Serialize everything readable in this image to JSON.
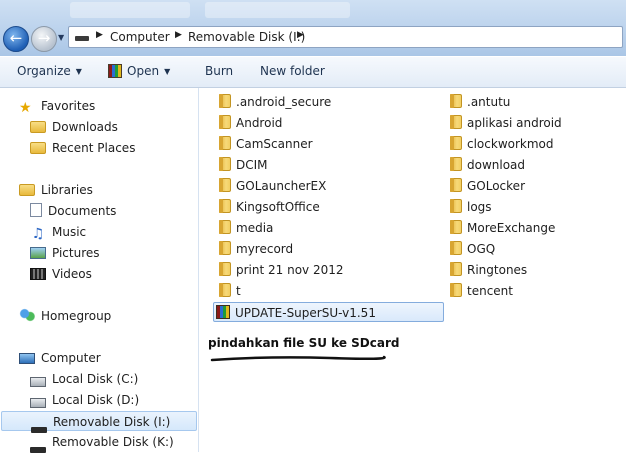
{
  "address": {
    "segments": [
      "Computer",
      "Removable Disk (I:)"
    ]
  },
  "toolbar": {
    "organize": "Organize",
    "open": "Open",
    "burn": "Burn",
    "new_folder": "New folder"
  },
  "nav": {
    "favorites": "Favorites",
    "downloads": "Downloads",
    "recent_places": "Recent Places",
    "libraries": "Libraries",
    "documents": "Documents",
    "music": "Music",
    "pictures": "Pictures",
    "videos": "Videos",
    "homegroup": "Homegroup",
    "computer": "Computer",
    "local_c": "Local Disk (C:)",
    "local_d": "Local Disk (D:)",
    "removable_i": "Removable Disk (I:)",
    "removable_k": "Removable Disk (K:)"
  },
  "files": {
    "col1": [
      ".android_secure",
      "Android",
      "CamScanner",
      "DCIM",
      "GOLauncherEX",
      "KingsoftOffice",
      "media",
      "myrecord",
      "print 21 nov 2012",
      "t",
      "UPDATE-SuperSU-v1.51"
    ],
    "col2": [
      ".antutu",
      "aplikasi android",
      "clockworkmod",
      "download",
      "GOLocker",
      "logs",
      "MoreExchange",
      "OGQ",
      "Ringtones",
      "tencent"
    ]
  },
  "annotation": "pindahkan file SU ke SDcard",
  "colors": {
    "selection": "#d9e9fb",
    "folder": "#f2cf63",
    "accent_blue": "#1f5fb5"
  }
}
